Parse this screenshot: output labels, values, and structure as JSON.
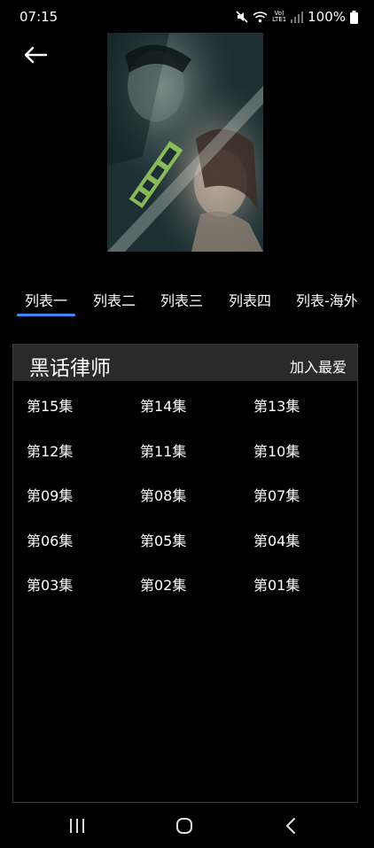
{
  "status_bar": {
    "time": "07:15",
    "network_label": "Vo) LTE1",
    "battery": "100%",
    "icons": [
      "mute-icon",
      "wifi-icon",
      "signal-icon",
      "battery-icon"
    ]
  },
  "header": {
    "back_icon": "arrow-left-icon"
  },
  "tabs": [
    {
      "label": "列表一",
      "selected": true
    },
    {
      "label": "列表二",
      "selected": false
    },
    {
      "label": "列表三",
      "selected": false
    },
    {
      "label": "列表四",
      "selected": false
    },
    {
      "label": "列表-海外",
      "selected": false
    }
  ],
  "panel": {
    "title": "黑话律师",
    "add_favorite_label": "加入最爱",
    "episodes": [
      "第15集",
      "第14集",
      "第13集",
      "第12集",
      "第11集",
      "第10集",
      "第09集",
      "第08集",
      "第07集",
      "第06集",
      "第05集",
      "第04集",
      "第03集",
      "第02集",
      "第01集"
    ]
  },
  "colors": {
    "background": "#000000",
    "tab_indicator": "#3f87f5",
    "panel_header": "#2a2a2a"
  }
}
